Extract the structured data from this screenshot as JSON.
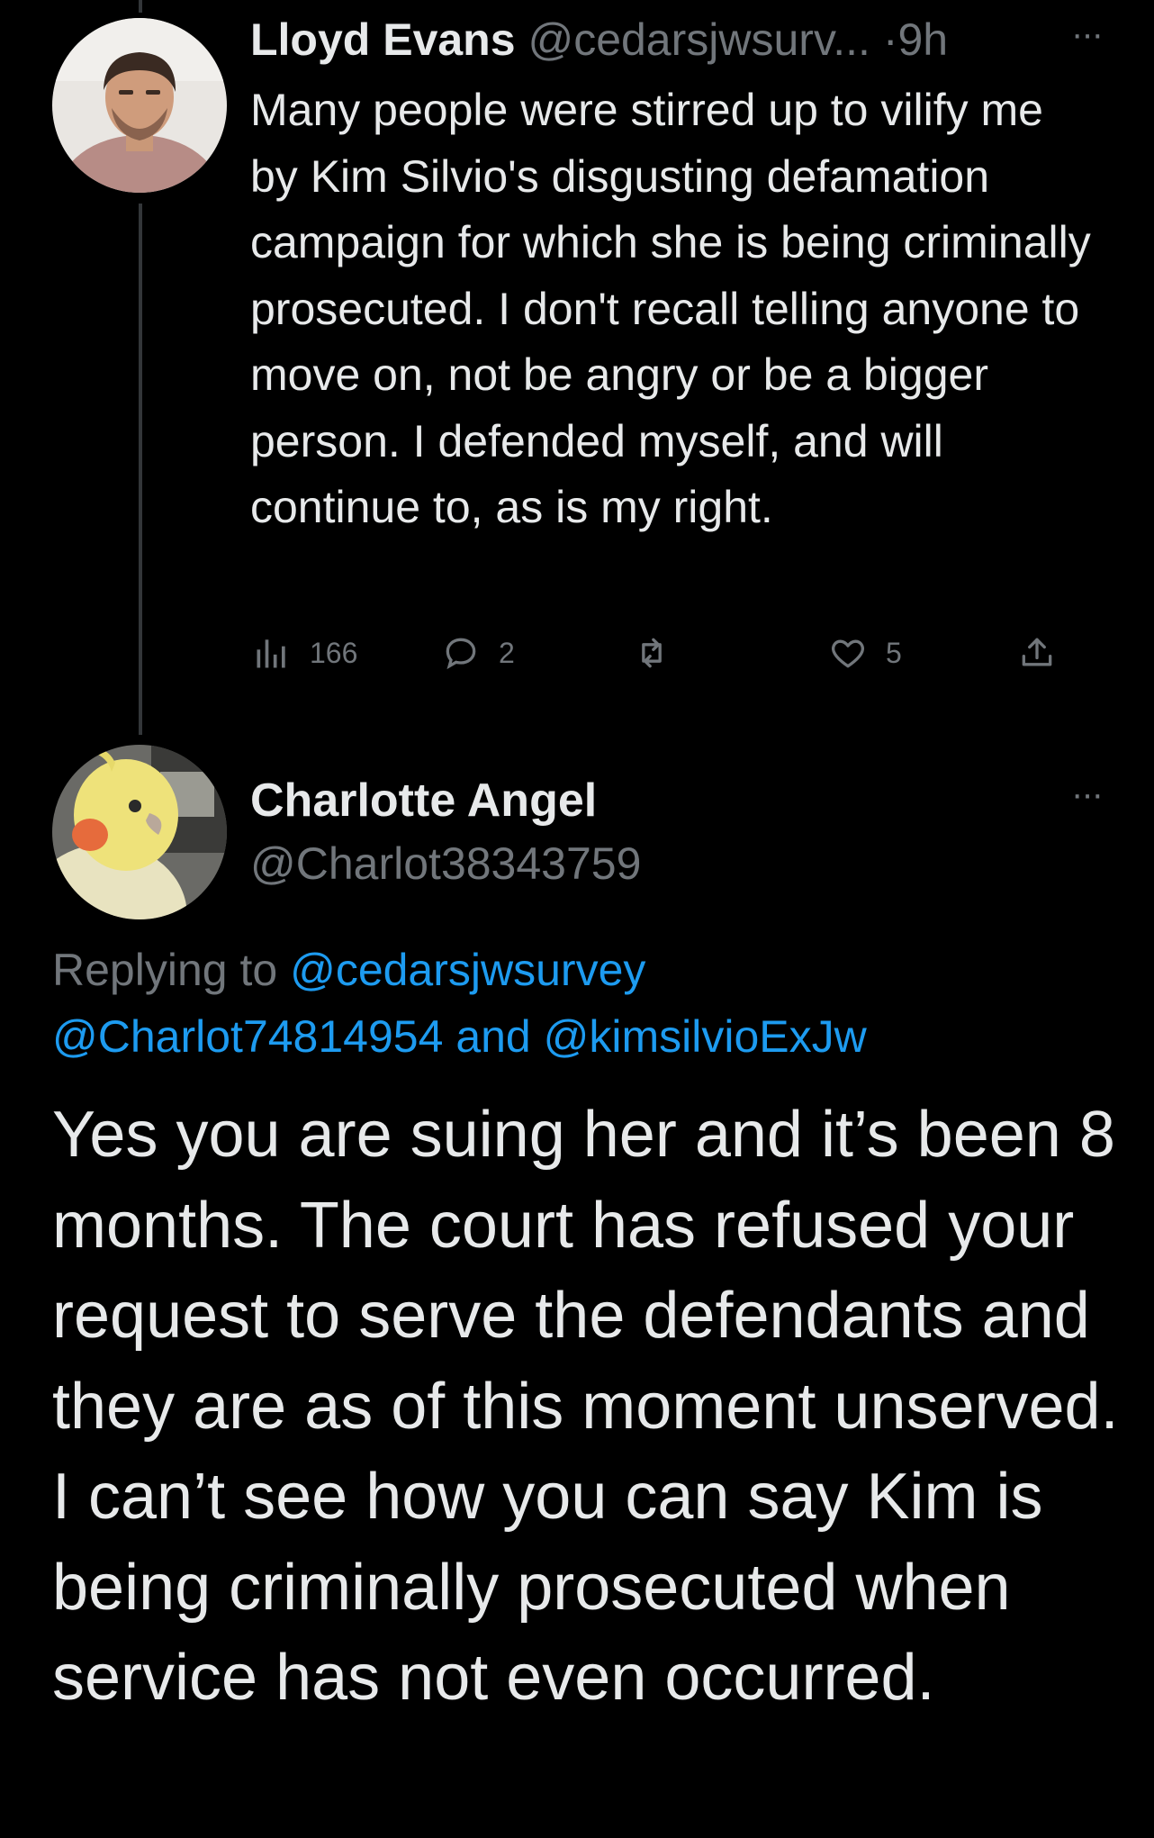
{
  "tweet1": {
    "author_name": "Lloyd Evans",
    "handle": "@cedarsjwsurv...",
    "separator": "·",
    "time": "9h",
    "more": "···",
    "text": "Many people were stirred up to vilify me by Kim Silvio's disgusting defamation campaign for which she is being criminally prosecuted. I don't recall telling anyone to move on, not be angry or be a bigger person. I defended myself, and will continue to, as is my right.",
    "actions": {
      "views": "166",
      "replies": "2",
      "retweets": "",
      "likes": "5"
    }
  },
  "tweet2": {
    "author_name": "Charlotte Angel",
    "handle": "@Charlot38343759",
    "more": "···",
    "replying_prefix": "Replying to",
    "replying_handle_1": "@cedarsjwsurvey",
    "replying_handle_2": "@Charlot74814954",
    "replying_and": "and",
    "replying_handle_3": "@kimsilvioExJw",
    "text": "Yes you are suing her and it’s been 8 months.  The court has refused your request to serve the defendants and they are as of this moment unserved.  I can’t see how you can say Kim is being criminally prosecuted when service has not even occurred."
  },
  "colors": {
    "background": "#000000",
    "text": "#e7e9ea",
    "muted": "#71767b",
    "link": "#1d9bf0",
    "thread_line": "#333639"
  },
  "icons": [
    "views-icon",
    "reply-icon",
    "retweet-icon",
    "like-icon",
    "share-icon",
    "more-icon"
  ]
}
